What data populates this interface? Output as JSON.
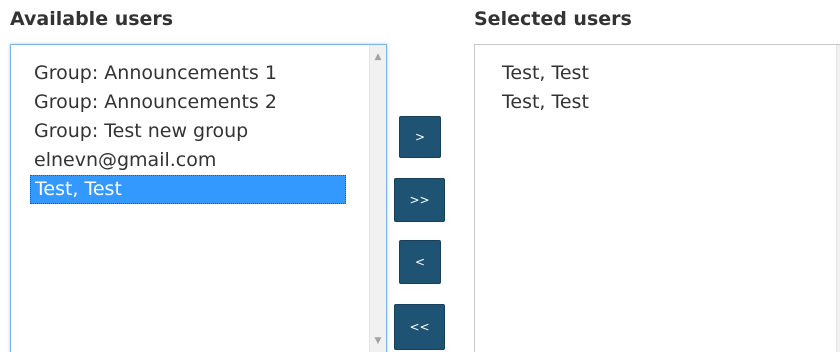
{
  "available": {
    "heading": "Available users",
    "options": [
      {
        "label": "Group: Announcements 1",
        "selected": false
      },
      {
        "label": "Group: Announcements 2",
        "selected": false
      },
      {
        "label": "Group: Test new group",
        "selected": false
      },
      {
        "label": "elnevn@gmail.com",
        "selected": false
      },
      {
        "label": "Test, Test",
        "selected": true
      }
    ]
  },
  "selected": {
    "heading": "Selected users",
    "options": [
      {
        "label": "Test, Test",
        "selected": false
      },
      {
        "label": "Test, Test",
        "selected": false
      }
    ]
  },
  "buttons": {
    "add": ">",
    "add_all": ">>",
    "remove": "<",
    "remove_all": "<<"
  },
  "colors": {
    "button_bg": "#1f5374",
    "selection_bg": "#3399ff",
    "focus_border": "#7ab4e8"
  },
  "icons": {
    "scroll_up": "triangle-up-icon",
    "scroll_down": "triangle-down-icon"
  }
}
